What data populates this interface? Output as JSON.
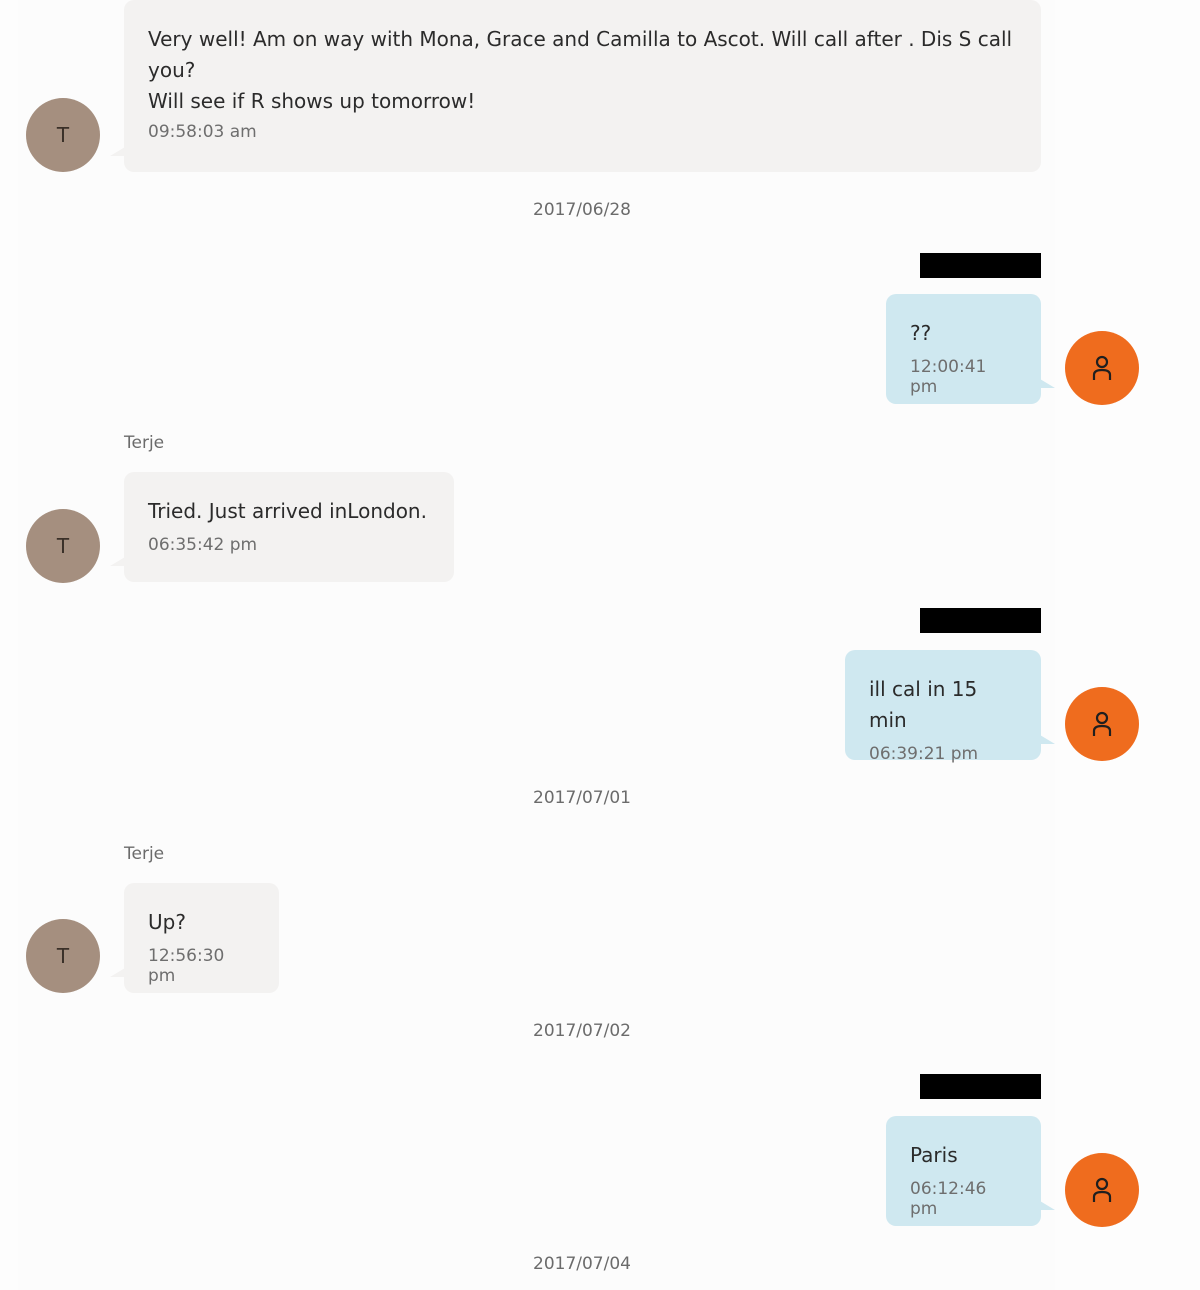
{
  "messages": [
    {
      "text": "Very well! Am on way with Mona, Grace and Camilla to Ascot. Will call after . Dis S call\nyou?\nWill see if R shows up tomorrow!",
      "time": "09:58:03 am",
      "avatar": "T"
    },
    {
      "date": "2017/06/28"
    },
    {
      "text": "??",
      "time": "12:00:41 pm",
      "avatar": "user-icon"
    },
    {
      "sender": "Terje",
      "text": "Tried. Just arrived inLondon.",
      "time": "06:35:42 pm",
      "avatar": "T"
    },
    {
      "text": "ill cal in 15 min",
      "time": "06:39:21 pm",
      "avatar": "user-icon"
    },
    {
      "date": "2017/07/01"
    },
    {
      "sender": "Terje",
      "text": "Up?",
      "time": "12:56:30 pm",
      "avatar": "T"
    },
    {
      "date": "2017/07/02"
    },
    {
      "text": "Paris",
      "time": "06:12:46 pm",
      "avatar": "user-icon"
    },
    {
      "date": "2017/07/04"
    }
  ],
  "colors": {
    "incoming_bubble": "#f3f2f1",
    "outgoing_bubble": "#cfe8f0",
    "contact_avatar": "#a58f7f",
    "own_avatar": "#ef6c1e"
  }
}
